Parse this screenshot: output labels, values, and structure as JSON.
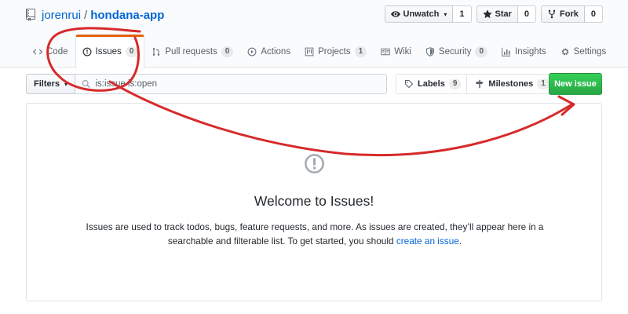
{
  "repo": {
    "owner": "jorenrui",
    "separator": "/",
    "name": "hondana-app"
  },
  "actions": {
    "watch": {
      "label": "Unwatch",
      "count": "1"
    },
    "star": {
      "label": "Star",
      "count": "0"
    },
    "fork": {
      "label": "Fork",
      "count": "0"
    }
  },
  "tabs": [
    {
      "label": "Code",
      "counter": ""
    },
    {
      "label": "Issues",
      "counter": "0"
    },
    {
      "label": "Pull requests",
      "counter": "0"
    },
    {
      "label": "Actions",
      "counter": ""
    },
    {
      "label": "Projects",
      "counter": "1"
    },
    {
      "label": "Wiki",
      "counter": ""
    },
    {
      "label": "Security",
      "counter": "0"
    },
    {
      "label": "Insights",
      "counter": ""
    },
    {
      "label": "Settings",
      "counter": ""
    }
  ],
  "filters": {
    "label": "Filters",
    "search_value": "is:issue is:open"
  },
  "labels": {
    "label": "Labels",
    "count": "9"
  },
  "milestones": {
    "label": "Milestones",
    "count": "1"
  },
  "new_issue_label": "New issue",
  "blankslate": {
    "title": "Welcome to Issues!",
    "text_1": "Issues are used to track todos, bugs, feature requests, and more. As issues are created, they’ll appear here in a searchable and filterable list. To get started, you should ",
    "link": "create an issue",
    "text_2": "."
  },
  "colors": {
    "accent": "#0366d6",
    "selected_tab": "#e36209",
    "primary_button": "#28a745",
    "annotation": "#d62a2a"
  }
}
